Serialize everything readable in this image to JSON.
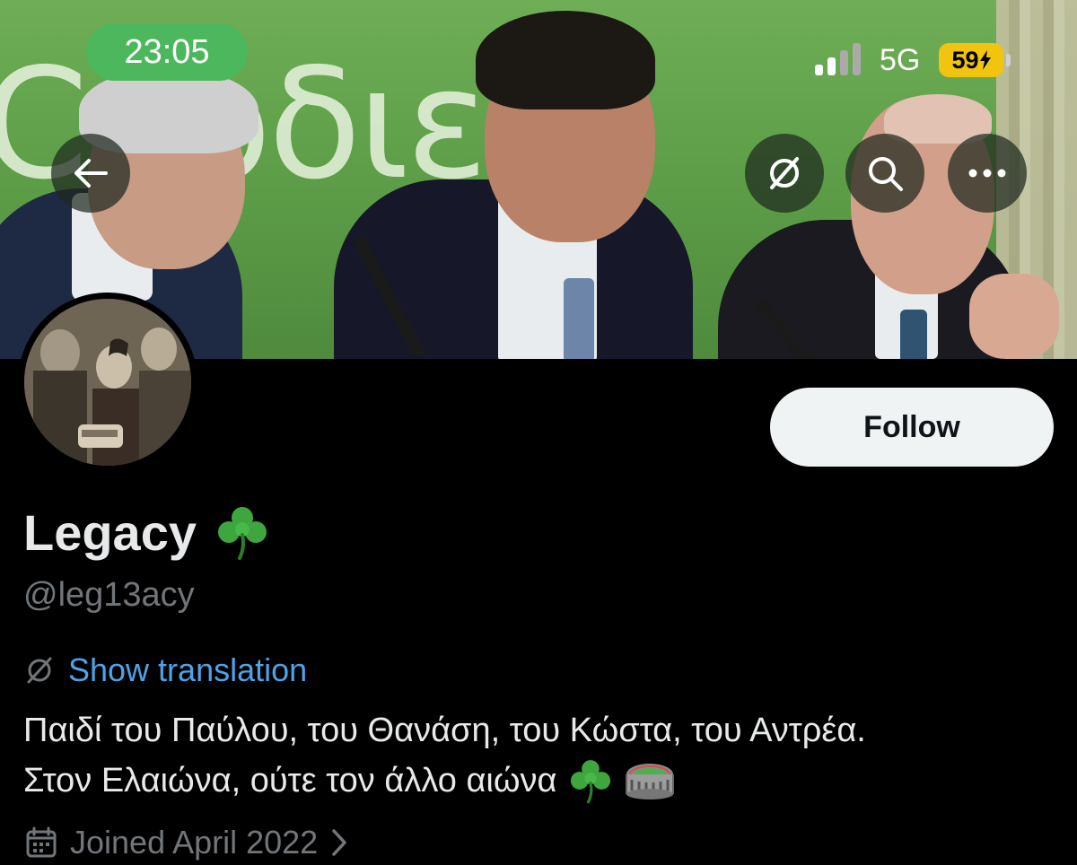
{
  "status_bar": {
    "time": "23:05",
    "network": "5G",
    "battery": "59"
  },
  "banner": {
    "background_text": "Cορδιε"
  },
  "header": {
    "back_icon": "arrow-left-icon",
    "translate_icon": "no-translate-icon",
    "search_icon": "search-icon",
    "more_icon": "more-horizontal-icon"
  },
  "profile": {
    "follow_label": "Follow",
    "display_name": "Legacy",
    "handle": "@leg13acy",
    "show_translation": "Show translation",
    "bio_line_1": "Παιδί του Παύλου, του Θανάση, του Κώστα, του Αντρέα.",
    "bio_line_2": "Στον Ελαιώνα, ούτε τον άλλο αιώνα",
    "joined": "Joined April 2022"
  },
  "colors": {
    "accent_link": "#4ea3e8",
    "time_pill": "#4cb75c",
    "battery": "#f1c40f"
  }
}
